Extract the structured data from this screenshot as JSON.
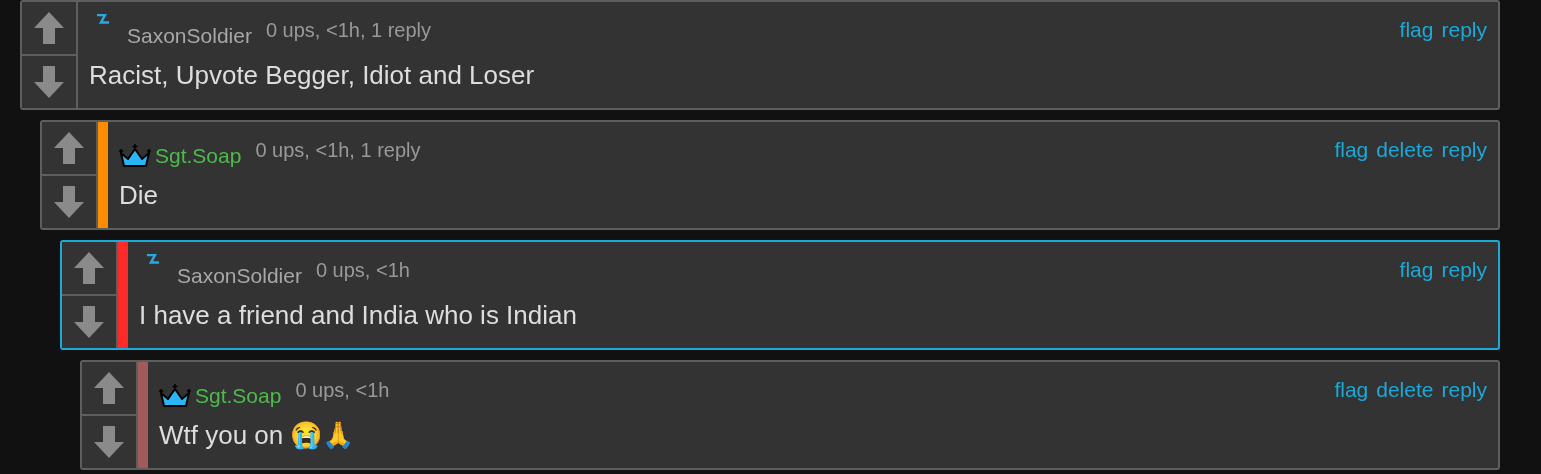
{
  "comments": [
    {
      "kind": "bolt",
      "username": "SaxonSoldier",
      "meta": "0 ups, <1h, 1 reply",
      "actions": [
        "flag",
        "reply"
      ],
      "highlighted": false,
      "body": "Racist, Upvote Begger, Idiot and Loser",
      "children": [
        {
          "kind": "crown",
          "username": "Sgt.Soap",
          "meta": "0 ups, <1h, 1 reply",
          "actions": [
            "flag",
            "delete",
            "reply"
          ],
          "highlighted": false,
          "color": "#ff8c00",
          "body": "Die",
          "children": [
            {
              "kind": "bolt",
              "username": "SaxonSoldier",
              "meta": "0 ups, <1h",
              "actions": [
                "flag",
                "reply"
              ],
              "highlighted": true,
              "color": "#ff2a2a",
              "body": "I have a friend and India who is Indian",
              "children": [
                {
                  "kind": "crown",
                  "username": "Sgt.Soap",
                  "meta": "0 ups, <1h",
                  "actions": [
                    "flag",
                    "delete",
                    "reply"
                  ],
                  "highlighted": false,
                  "color": "#a35a5a",
                  "body": "Wtf you on 😭🙏"
                }
              ]
            }
          ]
        }
      ]
    }
  ]
}
